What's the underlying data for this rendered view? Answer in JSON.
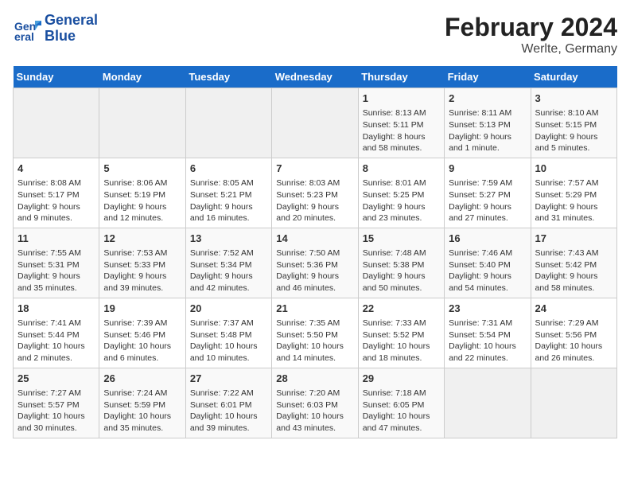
{
  "header": {
    "logo_line1": "General",
    "logo_line2": "Blue",
    "title": "February 2024",
    "subtitle": "Werlte, Germany"
  },
  "weekdays": [
    "Sunday",
    "Monday",
    "Tuesday",
    "Wednesday",
    "Thursday",
    "Friday",
    "Saturday"
  ],
  "weeks": [
    [
      {
        "day": "",
        "info": ""
      },
      {
        "day": "",
        "info": ""
      },
      {
        "day": "",
        "info": ""
      },
      {
        "day": "",
        "info": ""
      },
      {
        "day": "1",
        "info": "Sunrise: 8:13 AM\nSunset: 5:11 PM\nDaylight: 8 hours\nand 58 minutes."
      },
      {
        "day": "2",
        "info": "Sunrise: 8:11 AM\nSunset: 5:13 PM\nDaylight: 9 hours\nand 1 minute."
      },
      {
        "day": "3",
        "info": "Sunrise: 8:10 AM\nSunset: 5:15 PM\nDaylight: 9 hours\nand 5 minutes."
      }
    ],
    [
      {
        "day": "4",
        "info": "Sunrise: 8:08 AM\nSunset: 5:17 PM\nDaylight: 9 hours\nand 9 minutes."
      },
      {
        "day": "5",
        "info": "Sunrise: 8:06 AM\nSunset: 5:19 PM\nDaylight: 9 hours\nand 12 minutes."
      },
      {
        "day": "6",
        "info": "Sunrise: 8:05 AM\nSunset: 5:21 PM\nDaylight: 9 hours\nand 16 minutes."
      },
      {
        "day": "7",
        "info": "Sunrise: 8:03 AM\nSunset: 5:23 PM\nDaylight: 9 hours\nand 20 minutes."
      },
      {
        "day": "8",
        "info": "Sunrise: 8:01 AM\nSunset: 5:25 PM\nDaylight: 9 hours\nand 23 minutes."
      },
      {
        "day": "9",
        "info": "Sunrise: 7:59 AM\nSunset: 5:27 PM\nDaylight: 9 hours\nand 27 minutes."
      },
      {
        "day": "10",
        "info": "Sunrise: 7:57 AM\nSunset: 5:29 PM\nDaylight: 9 hours\nand 31 minutes."
      }
    ],
    [
      {
        "day": "11",
        "info": "Sunrise: 7:55 AM\nSunset: 5:31 PM\nDaylight: 9 hours\nand 35 minutes."
      },
      {
        "day": "12",
        "info": "Sunrise: 7:53 AM\nSunset: 5:33 PM\nDaylight: 9 hours\nand 39 minutes."
      },
      {
        "day": "13",
        "info": "Sunrise: 7:52 AM\nSunset: 5:34 PM\nDaylight: 9 hours\nand 42 minutes."
      },
      {
        "day": "14",
        "info": "Sunrise: 7:50 AM\nSunset: 5:36 PM\nDaylight: 9 hours\nand 46 minutes."
      },
      {
        "day": "15",
        "info": "Sunrise: 7:48 AM\nSunset: 5:38 PM\nDaylight: 9 hours\nand 50 minutes."
      },
      {
        "day": "16",
        "info": "Sunrise: 7:46 AM\nSunset: 5:40 PM\nDaylight: 9 hours\nand 54 minutes."
      },
      {
        "day": "17",
        "info": "Sunrise: 7:43 AM\nSunset: 5:42 PM\nDaylight: 9 hours\nand 58 minutes."
      }
    ],
    [
      {
        "day": "18",
        "info": "Sunrise: 7:41 AM\nSunset: 5:44 PM\nDaylight: 10 hours\nand 2 minutes."
      },
      {
        "day": "19",
        "info": "Sunrise: 7:39 AM\nSunset: 5:46 PM\nDaylight: 10 hours\nand 6 minutes."
      },
      {
        "day": "20",
        "info": "Sunrise: 7:37 AM\nSunset: 5:48 PM\nDaylight: 10 hours\nand 10 minutes."
      },
      {
        "day": "21",
        "info": "Sunrise: 7:35 AM\nSunset: 5:50 PM\nDaylight: 10 hours\nand 14 minutes."
      },
      {
        "day": "22",
        "info": "Sunrise: 7:33 AM\nSunset: 5:52 PM\nDaylight: 10 hours\nand 18 minutes."
      },
      {
        "day": "23",
        "info": "Sunrise: 7:31 AM\nSunset: 5:54 PM\nDaylight: 10 hours\nand 22 minutes."
      },
      {
        "day": "24",
        "info": "Sunrise: 7:29 AM\nSunset: 5:56 PM\nDaylight: 10 hours\nand 26 minutes."
      }
    ],
    [
      {
        "day": "25",
        "info": "Sunrise: 7:27 AM\nSunset: 5:57 PM\nDaylight: 10 hours\nand 30 minutes."
      },
      {
        "day": "26",
        "info": "Sunrise: 7:24 AM\nSunset: 5:59 PM\nDaylight: 10 hours\nand 35 minutes."
      },
      {
        "day": "27",
        "info": "Sunrise: 7:22 AM\nSunset: 6:01 PM\nDaylight: 10 hours\nand 39 minutes."
      },
      {
        "day": "28",
        "info": "Sunrise: 7:20 AM\nSunset: 6:03 PM\nDaylight: 10 hours\nand 43 minutes."
      },
      {
        "day": "29",
        "info": "Sunrise: 7:18 AM\nSunset: 6:05 PM\nDaylight: 10 hours\nand 47 minutes."
      },
      {
        "day": "",
        "info": ""
      },
      {
        "day": "",
        "info": ""
      }
    ]
  ]
}
